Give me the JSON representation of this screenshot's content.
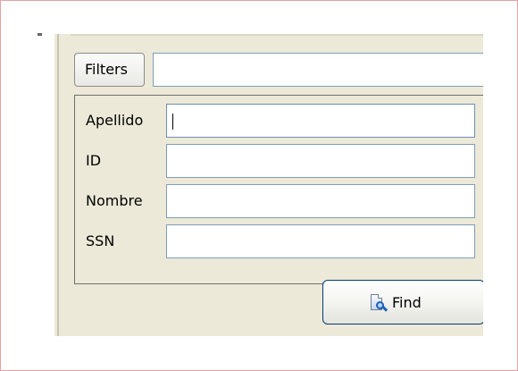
{
  "filters": {
    "tab_label": "Filters",
    "input_value": ""
  },
  "fields": [
    {
      "label": "Apellido",
      "value": ""
    },
    {
      "label": "ID",
      "value": ""
    },
    {
      "label": "Nombre",
      "value": ""
    },
    {
      "label": "SSN",
      "value": ""
    }
  ],
  "actions": {
    "find_label": "Find",
    "find_icon": "search-document-icon"
  }
}
